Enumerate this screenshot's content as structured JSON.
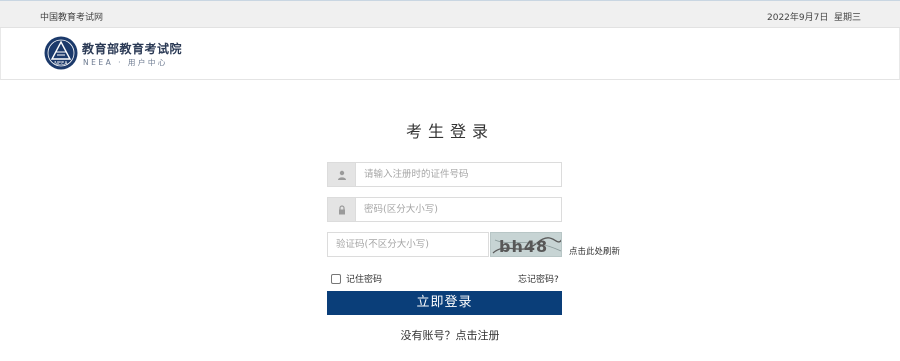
{
  "topbar": {
    "site_name": "中国教育考试网",
    "date": "2022年9月7日",
    "weekday": "星期三"
  },
  "header": {
    "logo_text": "NEEA",
    "title": "教育部教育考试院",
    "subtitle": "NEEA · 用户中心"
  },
  "login": {
    "title": "考生登录",
    "id_placeholder": "请输入注册时的证件号码",
    "password_placeholder": "密码(区分大小写)",
    "captcha_placeholder": "验证码(不区分大小写)",
    "captcha_text": "bh48",
    "refresh_label": "点击此处刷新",
    "remember_label": "记住密码",
    "forgot_label": "忘记密码?",
    "submit_label": "立即登录",
    "register_label": "没有账号？点击注册"
  },
  "icons": {
    "id_field": "user-icon",
    "password_field": "lock-icon"
  },
  "colors": {
    "primary_button": "#0a3e79",
    "logo": "#1c3a6b"
  }
}
